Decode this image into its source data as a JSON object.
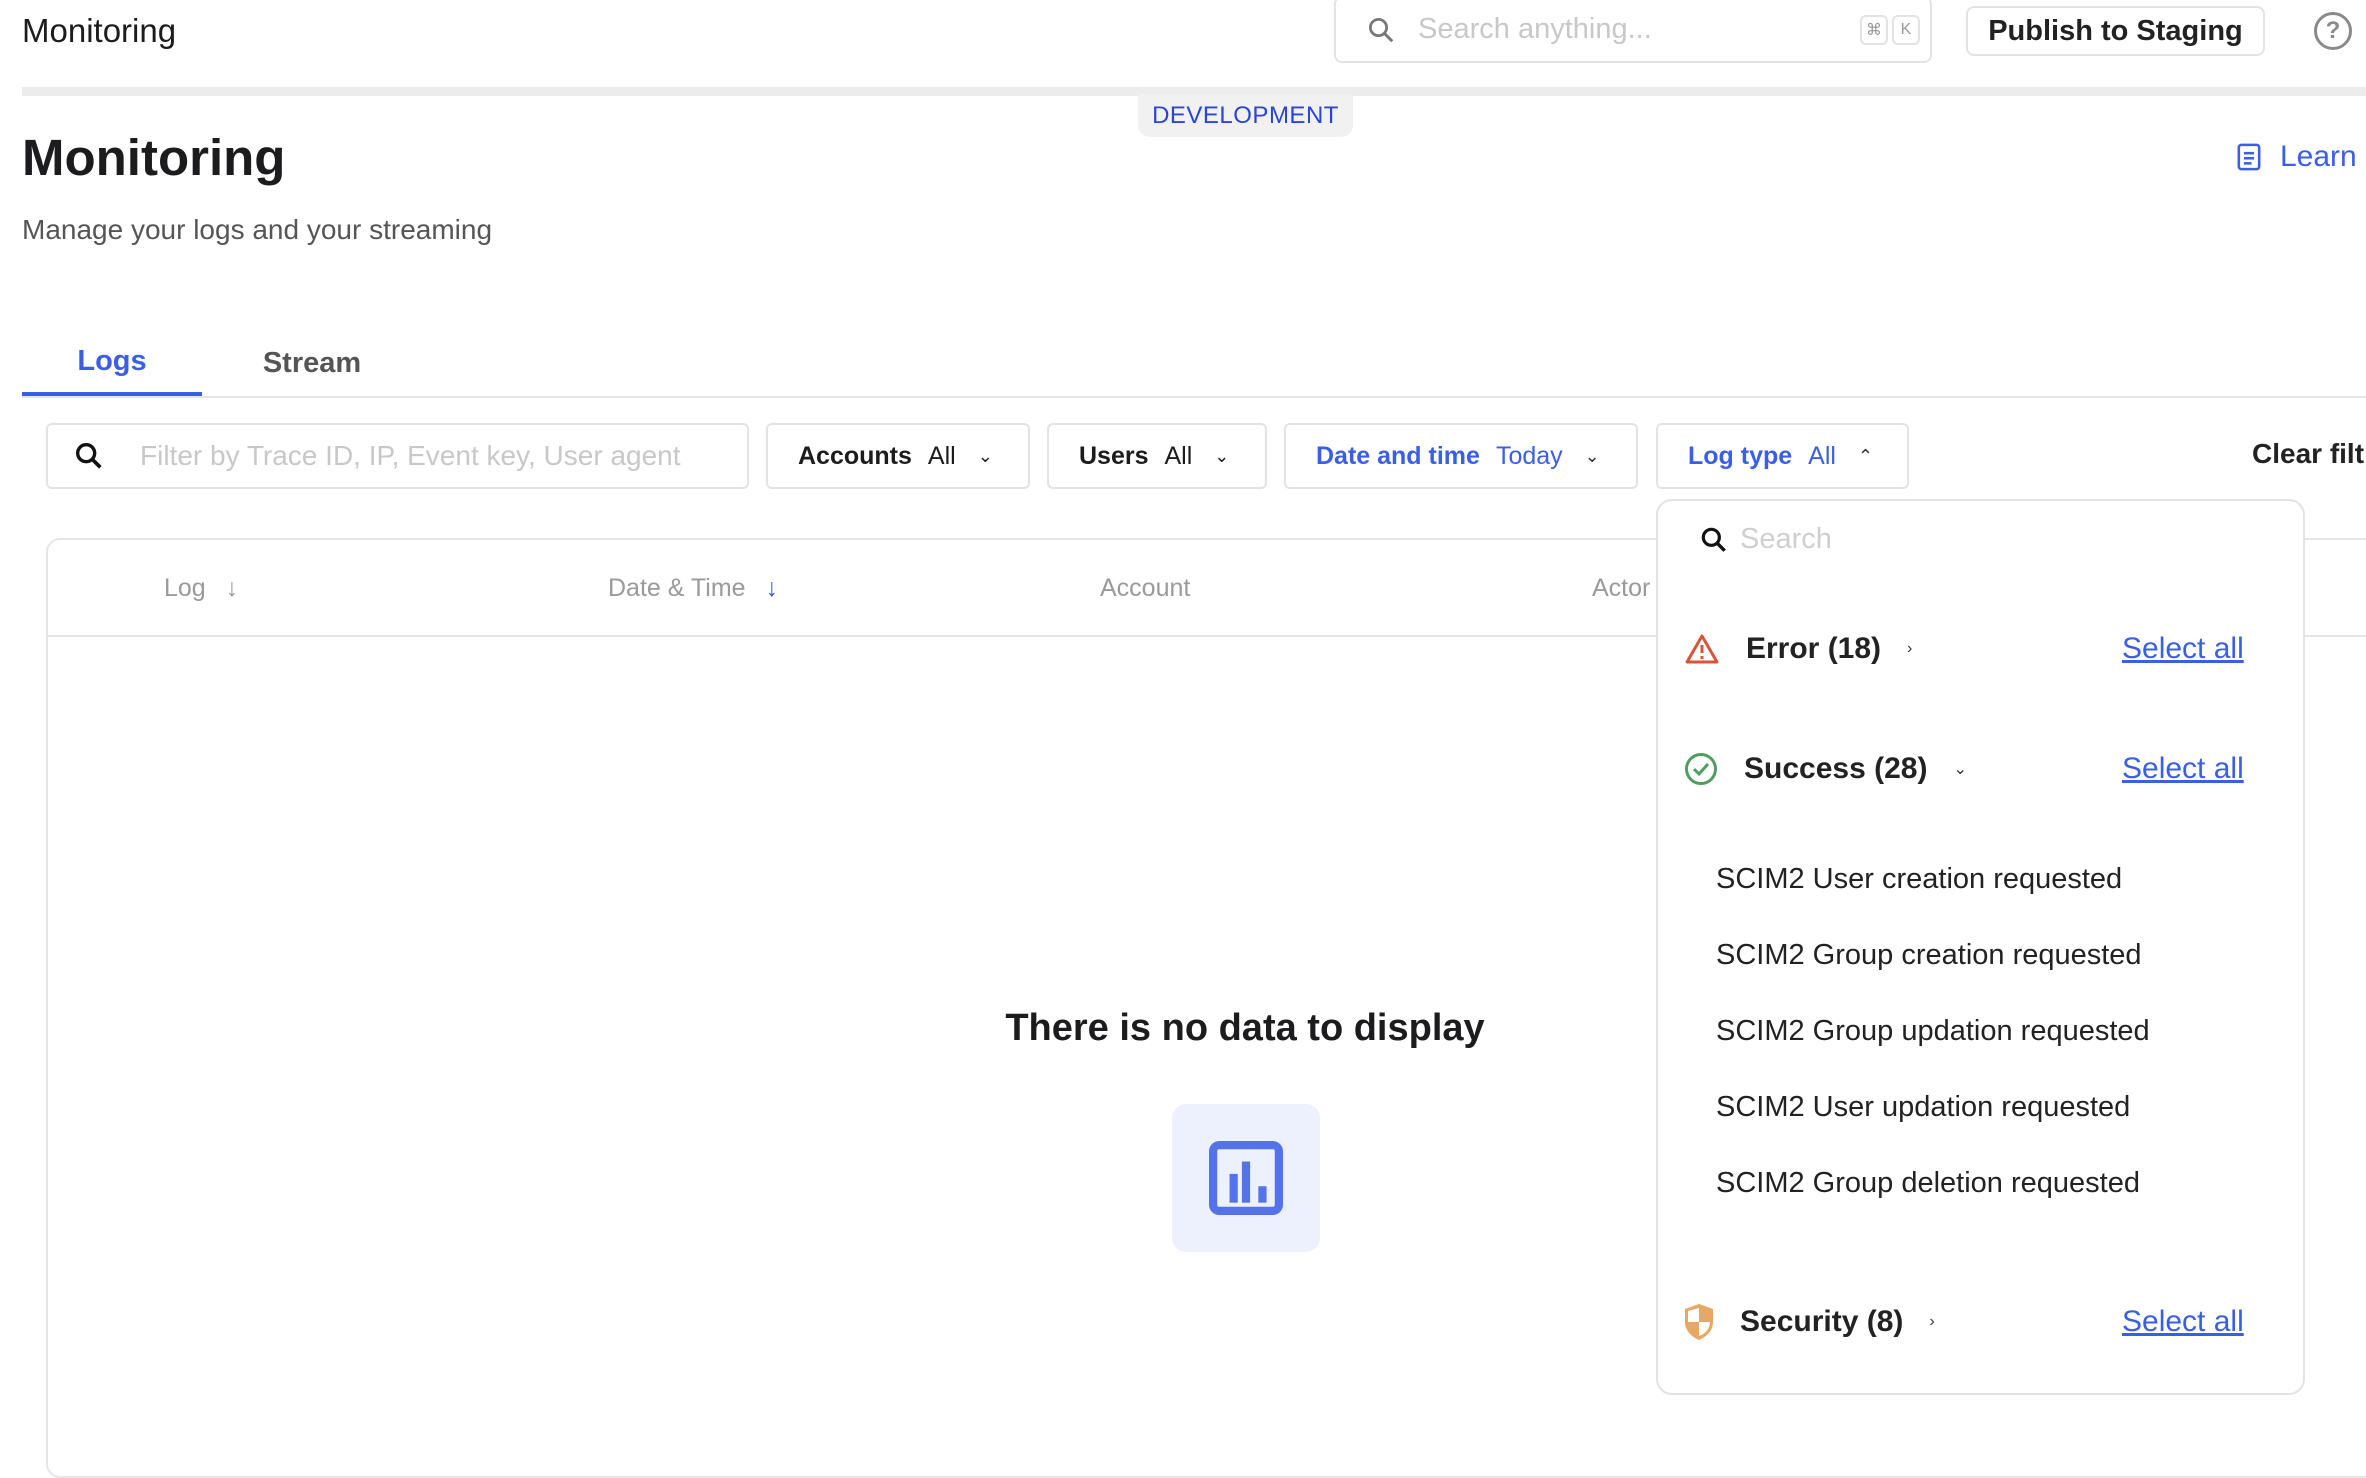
{
  "header": {
    "app_title": "Monitoring",
    "search_placeholder": "Search anything...",
    "shortcut_keys": [
      "⌘",
      "K"
    ],
    "publish_label": "Publish to Staging",
    "help_icon": "question-circle-icon"
  },
  "environment_badge": "DEVELOPMENT",
  "page": {
    "title": "Monitoring",
    "subtitle": "Manage your logs and your streaming",
    "learn_label": "Learn"
  },
  "tabs": [
    {
      "label": "Logs",
      "active": true
    },
    {
      "label": "Stream",
      "active": false
    }
  ],
  "filters": {
    "search_placeholder": "Filter by Trace ID, IP, Event key, User agent",
    "accounts": {
      "label": "Accounts",
      "value": "All"
    },
    "users": {
      "label": "Users",
      "value": "All"
    },
    "date": {
      "label": "Date and time",
      "value": "Today"
    },
    "log_type": {
      "label": "Log type",
      "value": "All"
    },
    "clear_label": "Clear filt"
  },
  "table": {
    "columns": [
      "Log",
      "Date & Time",
      "Account",
      "Actor"
    ],
    "empty_message": "There is no data to display"
  },
  "log_type_dropdown": {
    "search_placeholder": "Search",
    "groups": [
      {
        "label": "Error (18)",
        "select_all": "Select all",
        "color": "#d9553a",
        "expanded": false
      },
      {
        "label": "Success (28)",
        "select_all": "Select all",
        "color": "#4f9e5f",
        "expanded": true,
        "items": [
          "SCIM2 User creation requested",
          "SCIM2 Group creation requested",
          "SCIM2 Group updation requested",
          "SCIM2 User updation requested",
          "SCIM2 Group deletion requested"
        ]
      },
      {
        "label": "Security (8)",
        "select_all": "Select all",
        "color": "#e8a865",
        "expanded": false
      }
    ]
  },
  "colors": {
    "accent": "#3a5ee8"
  }
}
